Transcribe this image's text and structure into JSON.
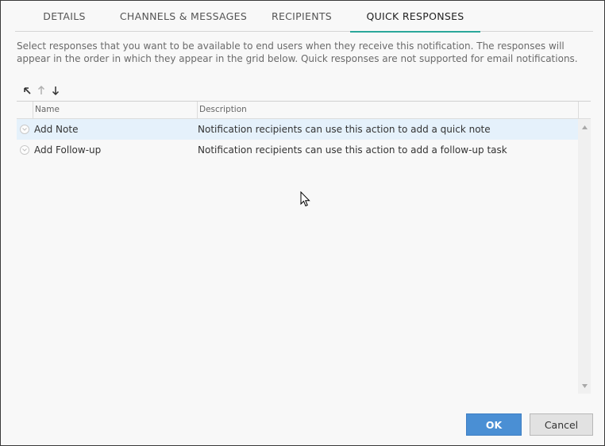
{
  "tabs": [
    {
      "label": "DETAILS",
      "active": false
    },
    {
      "label": "CHANNELS & MESSAGES",
      "active": false
    },
    {
      "label": "RECIPIENTS",
      "active": false
    },
    {
      "label": "QUICK RESPONSES",
      "active": true
    }
  ],
  "description": "Select responses that you want to be available to end users when they receive this notification. The responses will appear in the order in which they appear in the grid below. Quick responses are not supported for email notifications.",
  "toolbar": {
    "move_top_icon": "arrow-up-left-icon",
    "move_up_icon": "arrow-up-icon",
    "move_down_icon": "arrow-down-icon"
  },
  "grid": {
    "columns": [
      "Name",
      "Description"
    ],
    "rows": [
      {
        "name": "Add Note",
        "description": "Notification recipients can use this action to add a quick note",
        "selected": true
      },
      {
        "name": "Add Follow-up",
        "description": "Notification recipients can use this action to add a follow-up task",
        "selected": false
      }
    ]
  },
  "buttons": {
    "ok": "OK",
    "cancel": "Cancel"
  },
  "colors": {
    "accent": "#2aa79b",
    "ok_button": "#4a8fd4",
    "selected_row": "#e5f1fb"
  }
}
